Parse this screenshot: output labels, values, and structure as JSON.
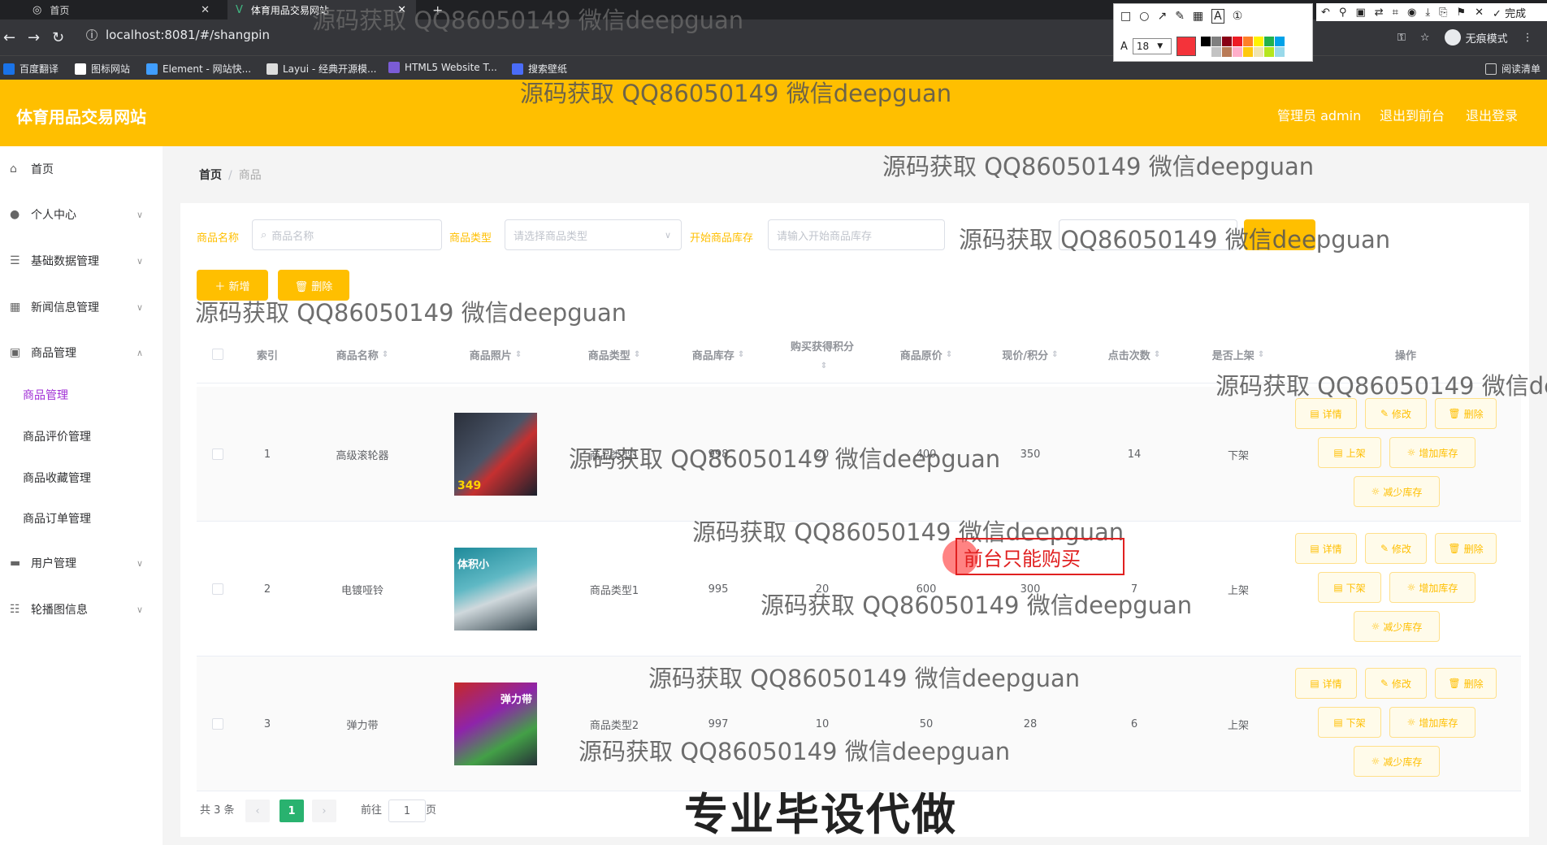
{
  "browser": {
    "tabs": [
      {
        "title": "首页",
        "active": false
      },
      {
        "title": "体育用品交易网站",
        "active": true
      }
    ],
    "new_tab": "+",
    "url": "localhost:8081/#/shangpin",
    "bookmarks": [
      "百度翻译",
      "图标网站",
      "Element - 网站快...",
      "Layui - 经典开源模...",
      "HTML5 Website T...",
      "搜索壁纸"
    ],
    "reading_list": "阅读清单",
    "profile": "无痕模式",
    "tool_right_label": "完成",
    "font_size": "18",
    "font_label": "A",
    "palette_colors": [
      "#000000",
      "#7f7f7f",
      "#880015",
      "#ed1c24",
      "#ff7f27",
      "#fff200",
      "#22b14c",
      "#00a2e8",
      "#ffffff",
      "#c3c3c3",
      "#b97a57",
      "#ffaec9",
      "#ffc90e",
      "#efe4b0",
      "#b5e61d",
      "#99d9ea"
    ],
    "accent": "#f4333a"
  },
  "header": {
    "title": "体育用品交易网站",
    "user": "管理员 admin",
    "to_front": "退出到前台",
    "logout": "退出登录",
    "color": "#ffbf00"
  },
  "sidebar": {
    "items": [
      {
        "label": "首页",
        "icon": "home-icon"
      },
      {
        "label": "个人中心",
        "icon": "user-icon"
      },
      {
        "label": "基础数据管理",
        "icon": "list-icon"
      },
      {
        "label": "新闻信息管理",
        "icon": "grid-icon"
      },
      {
        "label": "商品管理",
        "icon": "box-icon"
      }
    ],
    "sub_items": [
      "商品管理",
      "商品评价管理",
      "商品收藏管理",
      "商品订单管理"
    ],
    "items_after": [
      {
        "label": "用户管理",
        "icon": "monitor-icon"
      },
      {
        "label": "轮播图信息",
        "icon": "sliders-icon"
      }
    ]
  },
  "breadcrumb": {
    "home": "首页",
    "current": "商品"
  },
  "filters": {
    "name_label": "商品名称",
    "name_placeholder": "商品名称",
    "type_label": "商品类型",
    "type_placeholder": "请选择商品类型",
    "stock_label": "开始商品库存",
    "stock_placeholder": "请输入开始商品库存"
  },
  "actions": {
    "add": "＋ 新增",
    "delete": "🗑 删除"
  },
  "table": {
    "headers": [
      "索引",
      "商品名称",
      "商品照片",
      "商品类型",
      "商品库存",
      "购买获得积分",
      "商品原价",
      "现价/积分",
      "点击次数",
      "是否上架",
      "操作"
    ],
    "rows": [
      {
        "index": "1",
        "name": "高级滚轮器",
        "type": "商品类型1",
        "stock": "998",
        "points": "20",
        "orig": "400",
        "price": "350",
        "clicks": "14",
        "shelf": "下架",
        "toggle": "上架",
        "img_label": "349"
      },
      {
        "index": "2",
        "name": "电镀哑铃",
        "type": "商品类型1",
        "stock": "995",
        "points": "20",
        "orig": "600",
        "price": "300",
        "clicks": "7",
        "shelf": "上架",
        "toggle": "下架",
        "img_label": "体积小"
      },
      {
        "index": "3",
        "name": "弹力带",
        "type": "商品类型2",
        "stock": "997",
        "points": "10",
        "orig": "50",
        "price": "28",
        "clicks": "6",
        "shelf": "上架",
        "toggle": "下架",
        "img_label": "弹力带"
      }
    ],
    "op_detail": "详情",
    "op_edit": "修改",
    "op_delete": "删除",
    "op_add_stock": "增加库存",
    "op_reduce_stock": "减少库存"
  },
  "pagination": {
    "total": "共 3 条",
    "page": "1",
    "goto": "前往",
    "goto_value": "1",
    "page_unit": "页"
  },
  "overlays": {
    "watermark": "源码获取 QQ86050149 微信deepguan",
    "annotation": "前台只能购买",
    "caption": "专业毕设代做"
  }
}
